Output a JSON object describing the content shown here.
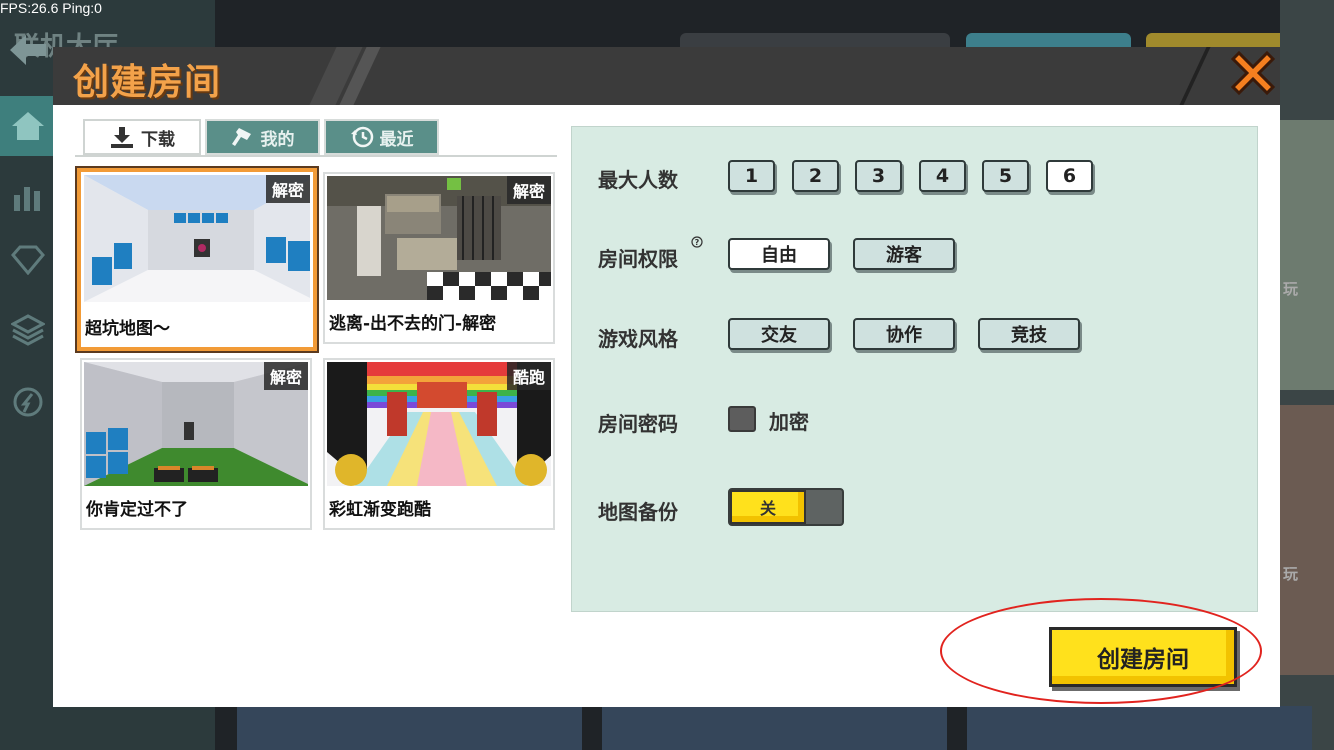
{
  "status": {
    "fps_text": "FPS:26.6  Ping:0"
  },
  "background": {
    "title": "联机大厅",
    "side_label_1": "玩",
    "side_label_2": "玩"
  },
  "dialog": {
    "title": "创建房间",
    "tabs": [
      {
        "label": "下载",
        "icon": "download-icon",
        "active": true
      },
      {
        "label": "我的",
        "icon": "hammer-icon",
        "active": false
      },
      {
        "label": "最近",
        "icon": "history-icon",
        "active": false
      }
    ],
    "maps": [
      {
        "name": "超坑地图～",
        "tag": "解密",
        "selected": true
      },
      {
        "name": "逃离-出不去的门-解密",
        "tag": "解密",
        "selected": false
      },
      {
        "name": "你肯定过不了",
        "tag": "解密",
        "selected": false
      },
      {
        "name": "彩虹渐变跑酷",
        "tag": "酷跑",
        "selected": false
      }
    ],
    "settings": {
      "max_players": {
        "label": "最大人数",
        "options": [
          "1",
          "2",
          "3",
          "4",
          "5",
          "6"
        ],
        "selected": "6"
      },
      "permission": {
        "label": "房间权限",
        "help": "?",
        "options": [
          "自由",
          "游客"
        ],
        "selected": "自由"
      },
      "style": {
        "label": "游戏风格",
        "options": [
          "交友",
          "协作",
          "竞技"
        ]
      },
      "password": {
        "label": "房间密码",
        "checkbox_label": "加密",
        "checked": false
      },
      "backup": {
        "label": "地图备份",
        "toggle_text": "关",
        "on": false
      }
    },
    "create_button": "创建房间"
  },
  "colors": {
    "accent_orange": "#f3a24a",
    "button_yellow": "#ffe11c",
    "panel_green": "#d8ebe3",
    "tab_teal": "#5a8f89",
    "annotation_red": "#e1231e"
  }
}
